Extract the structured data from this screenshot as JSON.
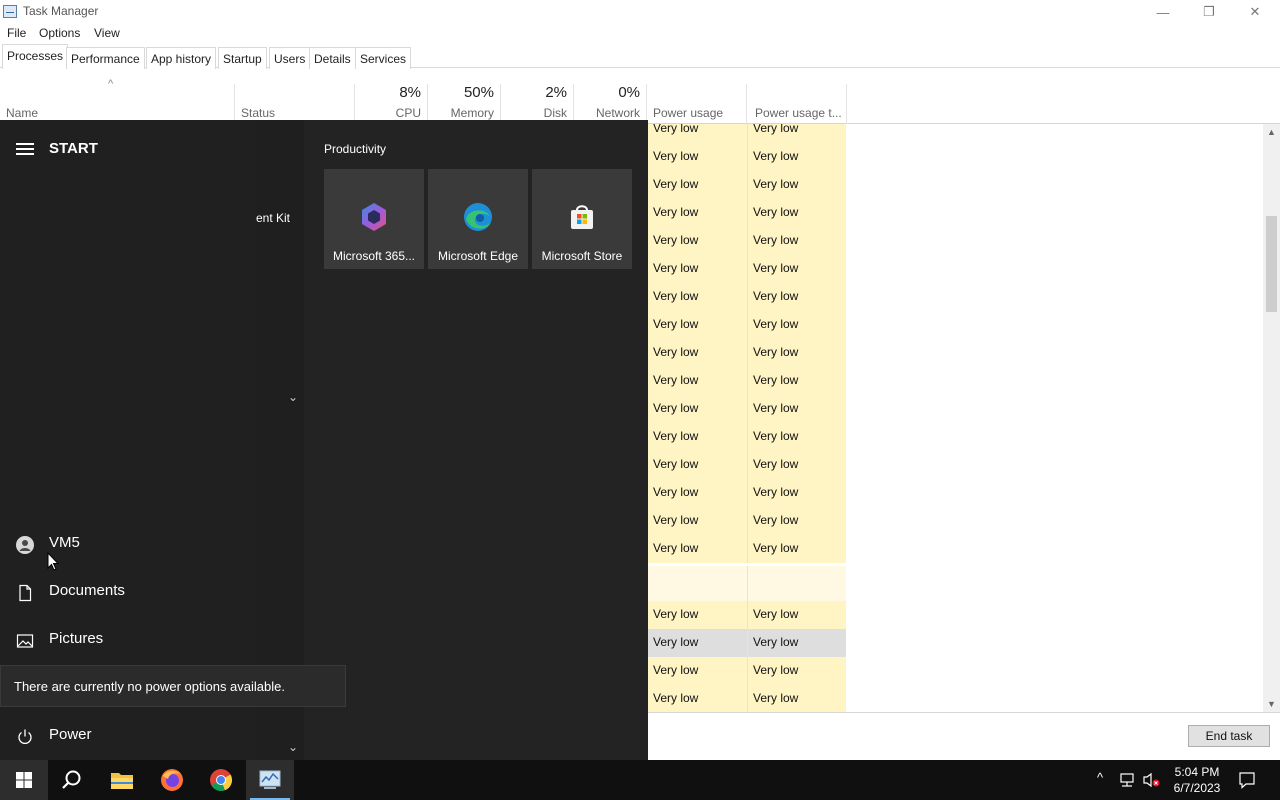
{
  "window": {
    "title": "Task Manager",
    "minimize": "—",
    "restore": "❐",
    "close": "✕"
  },
  "menu": [
    "File",
    "Options",
    "View"
  ],
  "tabs": [
    "Processes",
    "Performance",
    "App history",
    "Startup",
    "Users",
    "Details",
    "Services"
  ],
  "active_tab": "Processes",
  "columns": {
    "name": "Name",
    "status": "Status",
    "cpu": {
      "pct": "8%",
      "label": "CPU"
    },
    "memory": {
      "pct": "50%",
      "label": "Memory"
    },
    "disk": {
      "pct": "2%",
      "label": "Disk"
    },
    "network": {
      "pct": "0%",
      "label": "Network"
    },
    "power_usage": "Power usage",
    "power_usage_trend": "Power usage t...",
    "sort_indicator": "^"
  },
  "rows": [
    [
      "Very low",
      "Very low"
    ],
    [
      "Very low",
      "Very low"
    ],
    [
      "Very low",
      "Very low"
    ],
    [
      "Very low",
      "Very low"
    ],
    [
      "Very low",
      "Very low"
    ],
    [
      "Very low",
      "Very low"
    ],
    [
      "Very low",
      "Very low"
    ],
    [
      "Very low",
      "Very low"
    ],
    [
      "Very low",
      "Very low"
    ],
    [
      "Very low",
      "Very low"
    ],
    [
      "Very low",
      "Very low"
    ],
    [
      "Very low",
      "Very low"
    ],
    [
      "Very low",
      "Very low"
    ],
    [
      "Very low",
      "Very low"
    ],
    [
      "Very low",
      "Very low"
    ],
    [
      "Very low",
      "Very low"
    ],
    [
      "",
      ""
    ],
    [
      "Very low",
      "Very low"
    ],
    [
      "Very low",
      "Very low"
    ],
    [
      "Very low",
      "Very low"
    ],
    [
      "Very low",
      "Very low"
    ]
  ],
  "footer": {
    "end_task": "End task"
  },
  "start_menu": {
    "title": "START",
    "user": "VM5",
    "documents": "Documents",
    "pictures": "Pictures",
    "power": "Power",
    "group_title": "Productivity",
    "partial_text": "ent Kit",
    "tiles": [
      "Microsoft 365...",
      "Microsoft Edge",
      "Microsoft Store"
    ],
    "tooltip": "There are currently no power options available."
  },
  "taskbar": {
    "time": "5:04 PM",
    "date": "6/7/2023"
  },
  "colors": {
    "power_cell": "#fff4c4",
    "start_bg": "#202020",
    "taskbar_bg": "#101010"
  }
}
